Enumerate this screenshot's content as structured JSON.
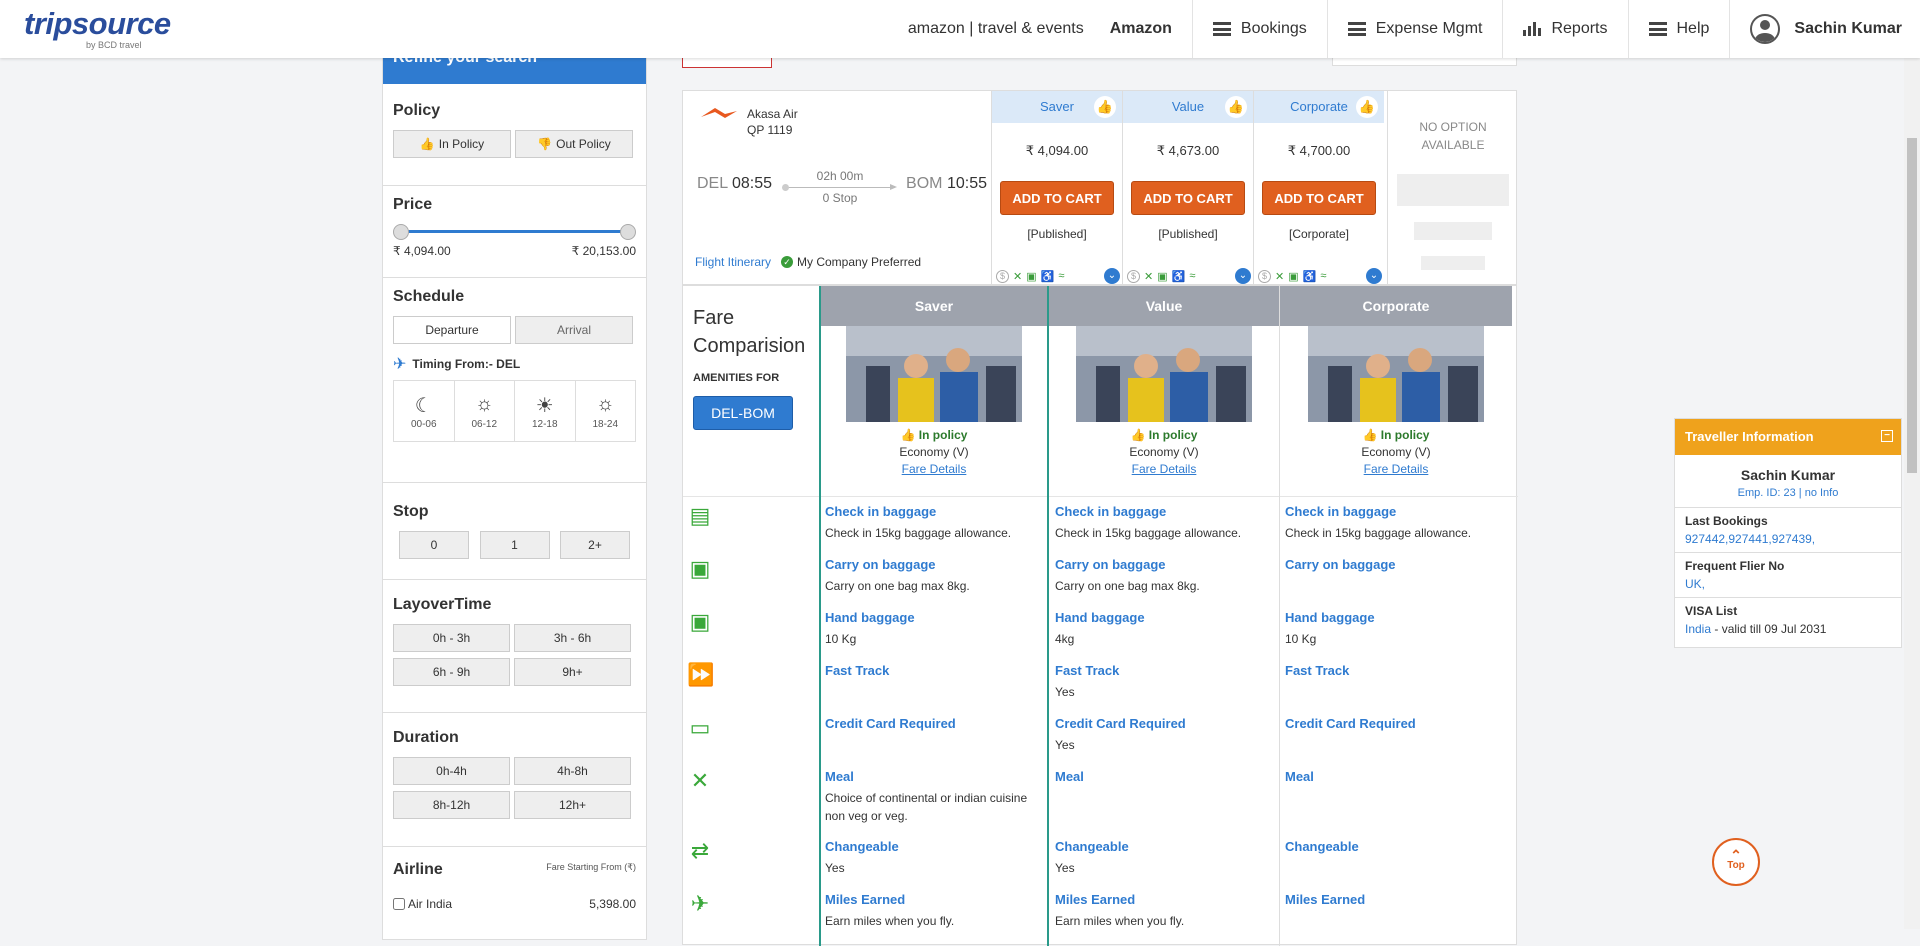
{
  "brand": {
    "logo": "tripsource",
    "sub": "by BCD travel"
  },
  "nav": [
    {
      "label": "amazon | travel & events",
      "bold": false
    },
    {
      "label": "Amazon",
      "bold": true
    },
    {
      "label": "Bookings"
    },
    {
      "label": "Expense Mgmt"
    },
    {
      "label": "Reports"
    },
    {
      "label": "Help"
    },
    {
      "label": "Sachin Kumar"
    }
  ],
  "sidebar": {
    "refine": "Refine your search",
    "policy": {
      "title": "Policy",
      "in": "In Policy",
      "out": "Out Policy"
    },
    "price": {
      "title": "Price",
      "min": "₹ 4,094.00",
      "max": "₹ 20,153.00"
    },
    "schedule": {
      "title": "Schedule",
      "departure": "Departure",
      "arrival": "Arrival",
      "timing": "Timing From:- DEL",
      "slots": [
        "00-06",
        "06-12",
        "12-18",
        "18-24"
      ]
    },
    "stop": {
      "title": "Stop",
      "options": [
        "0",
        "1",
        "2+"
      ]
    },
    "layover": {
      "title": "LayoverTime",
      "options": [
        "0h - 3h",
        "3h - 6h",
        "6h - 9h",
        "9h+"
      ]
    },
    "duration": {
      "title": "Duration",
      "options": [
        "0h-4h",
        "4h-8h",
        "8h-12h",
        "12h+"
      ]
    },
    "airline": {
      "title": "Airline",
      "fare_note": "Fare Starting From (₹)",
      "items": [
        {
          "name": "Air India",
          "price": "5,398.00"
        }
      ]
    }
  },
  "flight": {
    "airline": "Akasa Air",
    "number": "QP  1119",
    "dep_code": "DEL",
    "dep_time": "08:55",
    "arr_code": "BOM",
    "arr_time": "10:55",
    "duration": "02h 00m",
    "stops": "0 Stop",
    "itinerary": "Flight Itinerary",
    "preferred": "My Company Preferred",
    "fares": [
      {
        "name": "Saver",
        "price": "₹ 4,094.00",
        "button": "ADD TO CART",
        "type": "[Published]"
      },
      {
        "name": "Value",
        "price": "₹ 4,673.00",
        "button": "ADD TO CART",
        "type": "[Published]"
      },
      {
        "name": "Corporate",
        "price": "₹ 4,700.00",
        "button": "ADD TO CART",
        "type": "[Corporate]"
      }
    ],
    "no_option": "NO OPTION AVAILABLE"
  },
  "comparison": {
    "title": "Fare Comparision",
    "amenities_for": "AMENITIES FOR",
    "route": "DEL-BOM",
    "columns": [
      {
        "name": "Saver",
        "policy": "In policy",
        "cabin": "Economy (V)",
        "details": "Fare Details",
        "rows": [
          {
            "t": "Check in baggage",
            "d": "Check in 15kg baggage allowance."
          },
          {
            "t": "Carry on baggage",
            "d": "Carry on one bag max 8kg."
          },
          {
            "t": "Hand baggage",
            "d": "10 Kg"
          },
          {
            "t": "Fast Track",
            "d": ""
          },
          {
            "t": "Credit Card Required",
            "d": ""
          },
          {
            "t": "Meal",
            "d": "Choice of continental or indian cuisine non veg or veg."
          },
          {
            "t": "Changeable",
            "d": "Yes"
          },
          {
            "t": "Miles Earned",
            "d": "Earn miles when you fly."
          }
        ]
      },
      {
        "name": "Value",
        "policy": "In policy",
        "cabin": "Economy (V)",
        "details": "Fare Details",
        "rows": [
          {
            "t": "Check in baggage",
            "d": "Check in 15kg baggage allowance."
          },
          {
            "t": "Carry on baggage",
            "d": "Carry on one bag max 8kg."
          },
          {
            "t": "Hand baggage",
            "d": "4kg"
          },
          {
            "t": "Fast Track",
            "d": "Yes"
          },
          {
            "t": "Credit Card Required",
            "d": "Yes"
          },
          {
            "t": "Meal",
            "d": ""
          },
          {
            "t": "Changeable",
            "d": "Yes"
          },
          {
            "t": "Miles Earned",
            "d": "Earn miles when you fly."
          }
        ]
      },
      {
        "name": "Corporate",
        "policy": "In policy",
        "cabin": "Economy (V)",
        "details": "Fare Details",
        "rows": [
          {
            "t": "Check in baggage",
            "d": "Check in 15kg baggage allowance."
          },
          {
            "t": "Carry on baggage",
            "d": ""
          },
          {
            "t": "Hand baggage",
            "d": "10 Kg"
          },
          {
            "t": "Fast Track",
            "d": ""
          },
          {
            "t": "Credit Card Required",
            "d": ""
          },
          {
            "t": "Meal",
            "d": ""
          },
          {
            "t": "Changeable",
            "d": ""
          },
          {
            "t": "Miles Earned",
            "d": ""
          }
        ]
      }
    ]
  },
  "traveller": {
    "title": "Traveller Information",
    "name": "Sachin Kumar",
    "emp": "Emp. ID: 23 | no Info",
    "last_bookings_label": "Last Bookings",
    "last_bookings": "927442,927441,927439,",
    "ff_label": "Frequent Flier No",
    "ff": "UK,",
    "visa_label": "VISA List",
    "visa_country": "India",
    "visa_validity": " - valid till 09 Jul 2031"
  },
  "top_button": "Top",
  "colors": {
    "brand_blue": "#2f7bd0",
    "accent_orange": "#e0601f",
    "policy_green": "#3a9c3a",
    "traveller_header": "#efa21c"
  }
}
